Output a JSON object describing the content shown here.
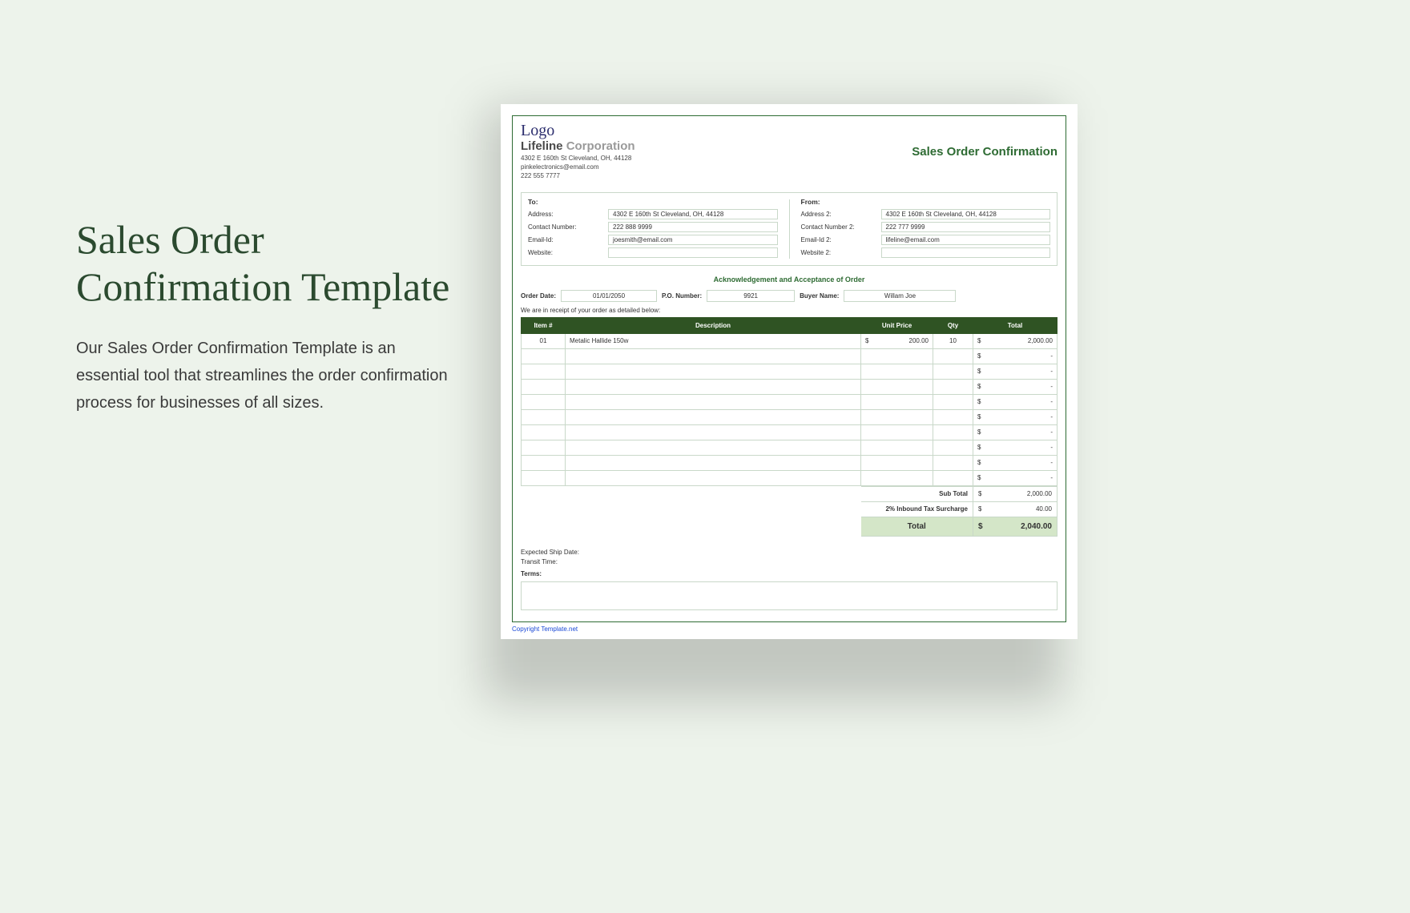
{
  "left": {
    "title": "Sales Order Confirmation Template",
    "description": "Our Sales Order Confirmation Template is an essential tool that streamlines the order confirmation process for businesses of all sizes."
  },
  "doc": {
    "logo_text": "Logo",
    "company": {
      "name_strong": "Lifeline",
      "name_light": "Corporation",
      "address": "4302 E 160th St Cleveland, OH, 44128",
      "email": "pinkelectronics@email.com",
      "phone": "222 555 7777"
    },
    "title": "Sales Order Confirmation",
    "to": {
      "header": "To:",
      "address_label": "Address:",
      "address_value": "4302 E 160th St Cleveland, OH, 44128",
      "contact_label": "Contact Number:",
      "contact_value": "222 888 9999",
      "email_label": "Email-Id:",
      "email_value": "joesmith@email.com",
      "website_label": "Website:",
      "website_value": ""
    },
    "from": {
      "header": "From:",
      "address_label": "Address 2:",
      "address_value": "4302 E 160th St Cleveland, OH, 44128",
      "contact_label": "Contact Number 2:",
      "contact_value": "222 777 9999",
      "email_label": "Email-Id 2:",
      "email_value": "lifeline@email.com",
      "website_label": "Website 2:",
      "website_value": ""
    },
    "ack": "Acknowledgement and Acceptance of Order",
    "meta": {
      "order_date_label": "Order Date:",
      "order_date_value": "01/01/2050",
      "po_label": "P.O. Number:",
      "po_value": "9921",
      "buyer_label": "Buyer Name:",
      "buyer_value": "Willam Joe"
    },
    "receipt_note": "We are in receipt of your order as detailed below:",
    "columns": {
      "item": "Item #",
      "desc": "Description",
      "unit": "Unit Price",
      "qty": "Qty",
      "total": "Total"
    },
    "rows": [
      {
        "item": "01",
        "desc": "Metalic Hallide 150w",
        "unit_cur": "$",
        "unit_val": "200.00",
        "qty": "10",
        "tot_cur": "$",
        "tot_val": "2,000.00"
      },
      {
        "item": "",
        "desc": "",
        "unit_cur": "",
        "unit_val": "",
        "qty": "",
        "tot_cur": "$",
        "tot_val": "-"
      },
      {
        "item": "",
        "desc": "",
        "unit_cur": "",
        "unit_val": "",
        "qty": "",
        "tot_cur": "$",
        "tot_val": "-"
      },
      {
        "item": "",
        "desc": "",
        "unit_cur": "",
        "unit_val": "",
        "qty": "",
        "tot_cur": "$",
        "tot_val": "-"
      },
      {
        "item": "",
        "desc": "",
        "unit_cur": "",
        "unit_val": "",
        "qty": "",
        "tot_cur": "$",
        "tot_val": "-"
      },
      {
        "item": "",
        "desc": "",
        "unit_cur": "",
        "unit_val": "",
        "qty": "",
        "tot_cur": "$",
        "tot_val": "-"
      },
      {
        "item": "",
        "desc": "",
        "unit_cur": "",
        "unit_val": "",
        "qty": "",
        "tot_cur": "$",
        "tot_val": "-"
      },
      {
        "item": "",
        "desc": "",
        "unit_cur": "",
        "unit_val": "",
        "qty": "",
        "tot_cur": "$",
        "tot_val": "-"
      },
      {
        "item": "",
        "desc": "",
        "unit_cur": "",
        "unit_val": "",
        "qty": "",
        "tot_cur": "$",
        "tot_val": "-"
      },
      {
        "item": "",
        "desc": "",
        "unit_cur": "",
        "unit_val": "",
        "qty": "",
        "tot_cur": "$",
        "tot_val": "-"
      }
    ],
    "summary": {
      "subtotal_label": "Sub Total",
      "subtotal_cur": "$",
      "subtotal_val": "2,000.00",
      "tax_label": "2% Inbound Tax Surcharge",
      "tax_cur": "$",
      "tax_val": "40.00",
      "total_label": "Total",
      "total_cur": "$",
      "total_val": "2,040.00"
    },
    "post": {
      "ship_date": "Expected Ship Date:",
      "transit": "Transit Time:",
      "terms": "Terms:"
    },
    "copyright": "Copyright Template.net"
  }
}
